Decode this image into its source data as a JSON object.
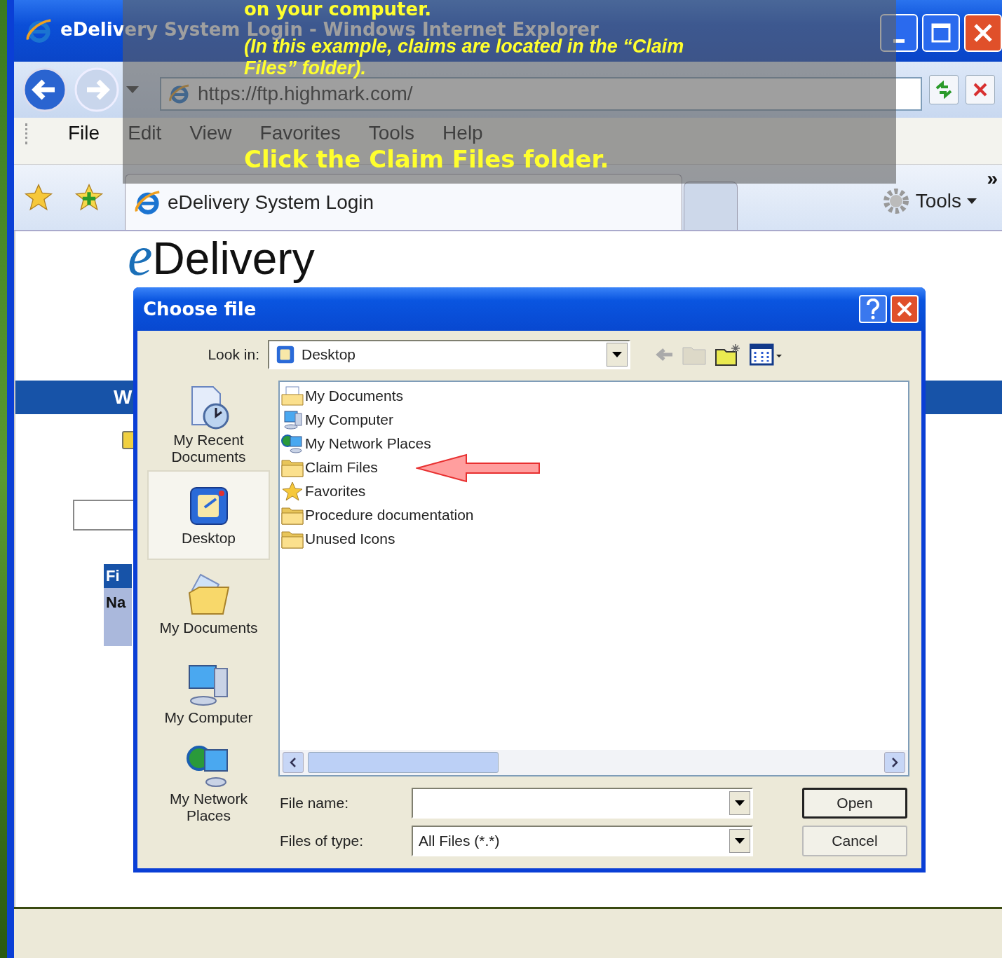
{
  "window": {
    "title": "eDelivery System Login - Windows Internet Explorer"
  },
  "address_bar": {
    "url": "https://ftp.highmark.com/"
  },
  "menu": [
    "File",
    "Edit",
    "View",
    "Favorites",
    "Tools",
    "Help"
  ],
  "tabs": [
    {
      "label": "eDelivery System Login",
      "selected": true
    }
  ],
  "command_bar": {
    "tools": "Tools",
    "more": "»"
  },
  "page": {
    "logo_mark": "e",
    "logo_text": "Delivery",
    "banner_text": "W",
    "section_header": "Fi",
    "field_label": "Na"
  },
  "dialog": {
    "title": "Choose file",
    "look_in_label": "Look in:",
    "look_in_value": "Desktop",
    "places": [
      {
        "label": "My Recent Documents",
        "kind": "recent",
        "selected": false
      },
      {
        "label": "Desktop",
        "kind": "desktop",
        "selected": true
      },
      {
        "label": "My Documents",
        "kind": "documents",
        "selected": false
      },
      {
        "label": "My Computer",
        "kind": "computer",
        "selected": false
      },
      {
        "label": "My Network Places",
        "kind": "network",
        "selected": false
      }
    ],
    "files": [
      {
        "name": "My Documents",
        "kind": "documents",
        "selected": false
      },
      {
        "name": "My Computer",
        "kind": "computer",
        "selected": false
      },
      {
        "name": "My Network Places",
        "kind": "network",
        "selected": false
      },
      {
        "name": "Claim Files",
        "kind": "folder",
        "selected": false
      },
      {
        "name": "Favorites",
        "kind": "favorites",
        "selected": false
      },
      {
        "name": "Procedure documentation",
        "kind": "folder",
        "selected": false
      },
      {
        "name": "Unused Icons",
        "kind": "folder",
        "selected": false
      }
    ],
    "file_name_label": "File name:",
    "files_of_type_label": "Files of type:",
    "files_of_type_value": "All Files (*.*)",
    "buttons": [
      {
        "label": "Open",
        "default": true
      },
      {
        "label": "Cancel",
        "default": false
      }
    ]
  },
  "callout": {
    "lines": [
      {
        "text": "on your computer.",
        "kind": "tail"
      },
      {
        "text": "(In this example, claims are located in the “Claim",
        "kind": "note"
      },
      {
        "text": "Files” folder).",
        "kind": "note"
      },
      {
        "text": "Click the Claim Files folder.",
        "kind": "instruction"
      }
    ]
  }
}
